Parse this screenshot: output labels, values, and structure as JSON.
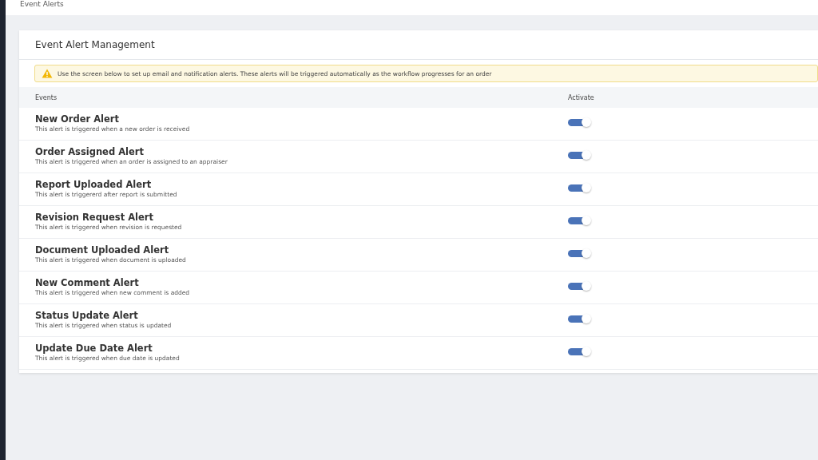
{
  "header": {
    "title": "Event Alerts"
  },
  "card": {
    "title": "Event Alert Management",
    "notice": "Use the screen below to set up email and notification alerts. These alerts will be triggered automatically as the workflow progresses for an order"
  },
  "table": {
    "columns": [
      "Events",
      "Activate"
    ],
    "rows": [
      {
        "name": "New Order Alert",
        "description": "This alert is triggered when a new order is received",
        "on": true
      },
      {
        "name": "Order Assigned Alert",
        "description": "This alert is triggered when an order is assigned to an appraiser",
        "on": true
      },
      {
        "name": "Report Uploaded Alert",
        "description": "This alert is triggererd after report is submitted",
        "on": true
      },
      {
        "name": "Revision Request Alert",
        "description": "This alert is triggered when revision is requested",
        "on": true
      },
      {
        "name": "Document Uploaded Alert",
        "description": "This alert is triggered when document is uploaded",
        "on": true
      },
      {
        "name": "New Comment Alert",
        "description": "This alert is triggered when new comment is added",
        "on": true
      },
      {
        "name": "Status Update Alert",
        "description": "This alert is triggered when status is updated",
        "on": true
      },
      {
        "name": "Update Due Date Alert",
        "description": "This alert is triggered when due date is updated",
        "on": true
      }
    ]
  }
}
